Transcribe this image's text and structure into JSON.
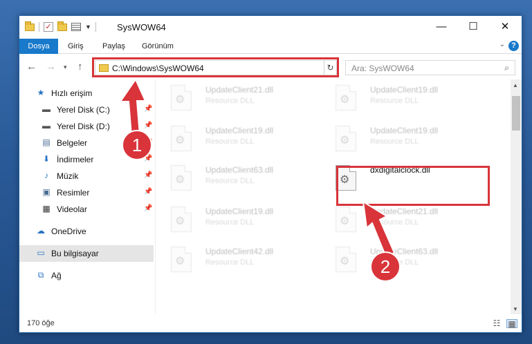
{
  "window": {
    "title": "SysWOW64",
    "controls": {
      "minimize": "—",
      "maximize": "☐",
      "close": "✕"
    }
  },
  "ribbon": {
    "tabs": [
      "Dosya",
      "Giriş",
      "Paylaş",
      "Görünüm"
    ],
    "help": "?"
  },
  "address": {
    "path": "C:\\Windows\\SysWOW64"
  },
  "search": {
    "placeholder": "Ara: SysWOW64"
  },
  "sidebar": {
    "items": [
      {
        "label": "Hızlı erişim",
        "icon": "star-icon"
      },
      {
        "label": "Yerel Disk (C:)",
        "icon": "drive-icon",
        "pinned": true
      },
      {
        "label": "Yerel Disk (D:)",
        "icon": "drive-icon",
        "pinned": true
      },
      {
        "label": "Belgeler",
        "icon": "documents-icon",
        "pinned": true
      },
      {
        "label": "İndirmeler",
        "icon": "download-icon",
        "pinned": true
      },
      {
        "label": "Müzik",
        "icon": "music-icon",
        "pinned": true
      },
      {
        "label": "Resimler",
        "icon": "pictures-icon",
        "pinned": true
      },
      {
        "label": "Videolar",
        "icon": "videos-icon",
        "pinned": true
      },
      {
        "label": "OneDrive",
        "icon": "cloud-icon"
      },
      {
        "label": "Bu bilgisayar",
        "icon": "computer-icon",
        "selected": true
      },
      {
        "label": "Ağ",
        "icon": "network-icon"
      }
    ]
  },
  "files": [
    {
      "name": "UpdateClient21.dll",
      "desc": "Resource DLL"
    },
    {
      "name": "UpdateClient19.dll",
      "desc": "Resource DLL"
    },
    {
      "name": "UpdateClient19.dll",
      "desc": "Resource DLL"
    },
    {
      "name": "UpdateClient19.dll",
      "desc": "Resource DLL"
    },
    {
      "name": "UpdateClient63.dll",
      "desc": "Resource DLL"
    },
    {
      "name": "dxdigitalclock.dll",
      "desc": "",
      "highlighted": true
    },
    {
      "name": "UpdateClient19.dll",
      "desc": "Resource DLL"
    },
    {
      "name": "UpdateClient21.dll",
      "desc": "Resource DLL"
    },
    {
      "name": "UpdateClient42.dll",
      "desc": "Resource DLL"
    },
    {
      "name": "UpdateClient63.dll",
      "desc": "Resource DLL"
    }
  ],
  "status": {
    "count": "170 öğe"
  },
  "callouts": [
    "1",
    "2"
  ],
  "colors": {
    "accent": "#1979ca",
    "highlight": "#d8343a",
    "selected": "#e5e5e5"
  }
}
